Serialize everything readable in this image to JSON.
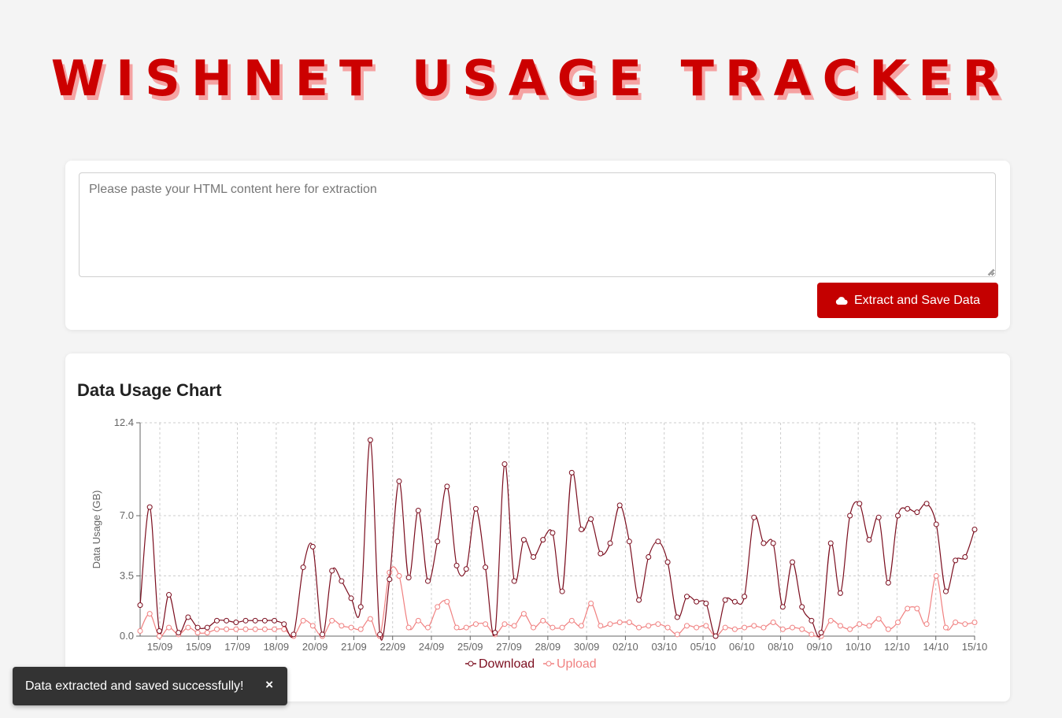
{
  "header": {
    "title": "WISHNET USAGE TRACKER"
  },
  "input": {
    "placeholder": "Please paste your HTML content here for extraction",
    "value": ""
  },
  "extract_button": {
    "label": "Extract and Save Data",
    "icon": "cloud-icon"
  },
  "chart_section": {
    "heading": "Data Usage Chart"
  },
  "toast": {
    "message": "Data extracted and saved successfully!",
    "close_label": "×"
  },
  "colors": {
    "accent": "#c40000",
    "title": "#cc0000",
    "title_shadow": "#f5a3a3",
    "download": "#7b0d1e",
    "upload": "#f08080",
    "grid": "#cccccc"
  },
  "chart_data": {
    "type": "line",
    "title": "",
    "xlabel": "",
    "ylabel": "Data Usage (GB)",
    "ylim": [
      0,
      12.4
    ],
    "y_ticks": [
      "0.0",
      "3.5",
      "7.0",
      "12.4"
    ],
    "x_tick_labels": [
      "15/09",
      "15/09",
      "17/09",
      "18/09",
      "20/09",
      "21/09",
      "22/09",
      "24/09",
      "25/09",
      "27/09",
      "28/09",
      "30/09",
      "02/10",
      "03/10",
      "05/10",
      "06/10",
      "08/10",
      "09/10",
      "10/10",
      "12/10",
      "14/10",
      "15/10"
    ],
    "grid": true,
    "legend_position": "bottom",
    "series": [
      {
        "name": "Download",
        "color": "#7b0d1e",
        "values": [
          1.8,
          7.5,
          0.3,
          2.4,
          0.2,
          1.1,
          0.5,
          0.5,
          0.9,
          0.9,
          0.8,
          0.9,
          0.9,
          0.9,
          0.9,
          0.7,
          0.1,
          4.0,
          5.2,
          0.1,
          3.8,
          3.2,
          2.2,
          1.7,
          11.4,
          0.1,
          3.3,
          9.0,
          3.4,
          7.3,
          3.2,
          5.5,
          8.7,
          4.1,
          3.9,
          7.4,
          4.0,
          0.2,
          10.0,
          3.2,
          5.6,
          4.6,
          5.6,
          6.0,
          2.6,
          9.5,
          6.2,
          6.8,
          4.8,
          5.4,
          7.6,
          5.5,
          2.1,
          4.6,
          5.5,
          4.3,
          1.1,
          2.3,
          2.0,
          1.9,
          0.0,
          2.1,
          2.0,
          2.3,
          6.9,
          5.4,
          5.4,
          1.7,
          4.3,
          1.7,
          0.9,
          0.2,
          5.4,
          2.5,
          7.0,
          7.7,
          5.6,
          6.9,
          3.1,
          7.0,
          7.4,
          7.2,
          7.7,
          6.5,
          2.6,
          4.4,
          4.6,
          6.2
        ]
      },
      {
        "name": "Upload",
        "color": "#f08080",
        "values": [
          0.3,
          1.3,
          0.0,
          0.5,
          0.1,
          0.5,
          0.2,
          0.2,
          0.4,
          0.4,
          0.4,
          0.4,
          0.4,
          0.4,
          0.4,
          0.4,
          0.0,
          0.9,
          0.6,
          0.0,
          0.9,
          0.6,
          0.5,
          0.4,
          1.0,
          0.0,
          3.7,
          3.5,
          0.5,
          0.9,
          0.5,
          1.7,
          2.0,
          0.5,
          0.5,
          0.7,
          0.7,
          0.1,
          0.7,
          0.6,
          1.3,
          0.5,
          0.9,
          0.5,
          0.5,
          0.9,
          0.6,
          1.9,
          0.6,
          0.7,
          0.8,
          0.8,
          0.5,
          0.6,
          0.7,
          0.5,
          0.1,
          0.6,
          0.5,
          0.6,
          0.0,
          0.5,
          0.4,
          0.5,
          0.6,
          0.5,
          0.8,
          0.4,
          0.5,
          0.4,
          0.1,
          0.0,
          0.9,
          0.6,
          0.4,
          0.7,
          0.6,
          1.0,
          0.4,
          0.8,
          1.6,
          1.6,
          0.7,
          3.5,
          0.5,
          0.8,
          0.7,
          0.8
        ]
      }
    ]
  }
}
